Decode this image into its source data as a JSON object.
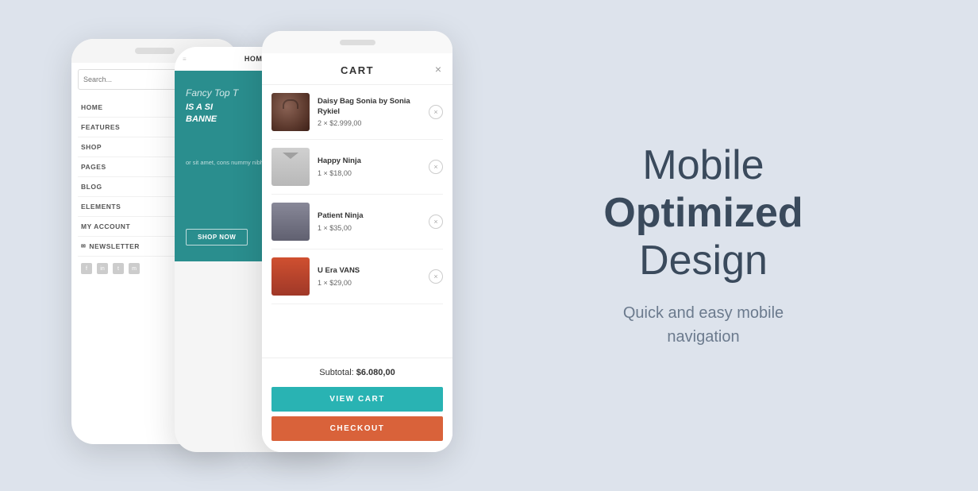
{
  "page": {
    "background": "#dde3ec"
  },
  "phones": {
    "back_phone": {
      "search_placeholder": "Search...",
      "nav_items": [
        {
          "label": "HOME",
          "has_chevron": true
        },
        {
          "label": "FEATURES",
          "has_chevron": true
        },
        {
          "label": "SHOP",
          "has_chevron": true
        },
        {
          "label": "PAGES",
          "has_chevron": true
        },
        {
          "label": "BLOG",
          "has_chevron": false
        },
        {
          "label": "ELEMENTS",
          "has_chevron": false
        },
        {
          "label": "MY ACCOUNT",
          "has_chevron": true
        }
      ],
      "newsletter_label": "NEWSLETTER",
      "social_icons": [
        "f",
        "in",
        "t",
        "m"
      ]
    },
    "mid_phone": {
      "header_text": "HOME",
      "banner_italic": "Fancy Top T",
      "banner_bold_line1": "IS A SI",
      "banner_bold_line2": "BANNE",
      "banner_body": "or sit amet, cons nummy nibh eu e magna aliqua",
      "shop_now": "SHOP NOW"
    },
    "front_phone": {
      "cart_title": "CART",
      "close_label": "×",
      "items": [
        {
          "name": "Daisy Bag Sonia by Sonia Rykiel",
          "qty": 2,
          "price": "$2.999,00",
          "img_type": "bag"
        },
        {
          "name": "Happy Ninja",
          "qty": 1,
          "price": "$18,00",
          "img_type": "shirt"
        },
        {
          "name": "Patient Ninja",
          "qty": 1,
          "price": "$35,00",
          "img_type": "hoodie"
        },
        {
          "name": "U Era VANS",
          "qty": 1,
          "price": "$29,00",
          "img_type": "pants"
        }
      ],
      "subtotal_label": "Subtotal:",
      "subtotal_value": "$6.080,00",
      "view_cart_label": "VIEW CART",
      "checkout_label": "CHECKOUT"
    }
  },
  "text_section": {
    "headline_normal": "Mobile",
    "headline_bold": "Optimized",
    "headline_normal2": "Design",
    "subheadline_line1": "Quick and easy mobile",
    "subheadline_line2": "navigation"
  }
}
